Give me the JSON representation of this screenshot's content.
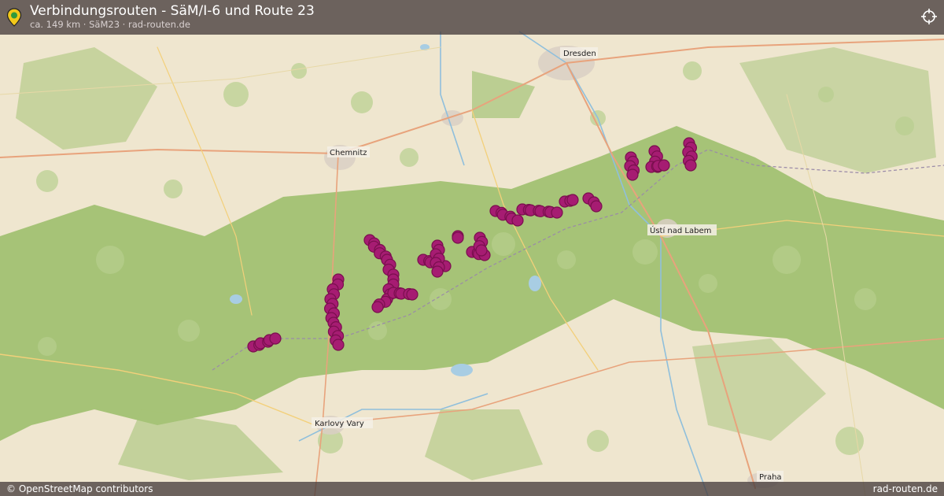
{
  "header": {
    "title": "Verbindungsrouten - SäM/I-6 und Route 23",
    "subtitle": "ca. 149 km · SäM23 · rad-routen.de",
    "pin_icon": "location-pin-icon",
    "cross_icon": "crosshair-icon"
  },
  "map": {
    "labels": {
      "dresden": "Dresden",
      "chemnitz": "Chemnitz",
      "usti": "Ústí nad Labem",
      "karlovy_vary": "Karlovy Vary",
      "praha": "Praha"
    },
    "route_color": "#a61c72",
    "route_outline": "#7a0f4e"
  },
  "footer": {
    "attribution": "© OpenStreetMap contributors",
    "site": "rad-routen.de"
  }
}
